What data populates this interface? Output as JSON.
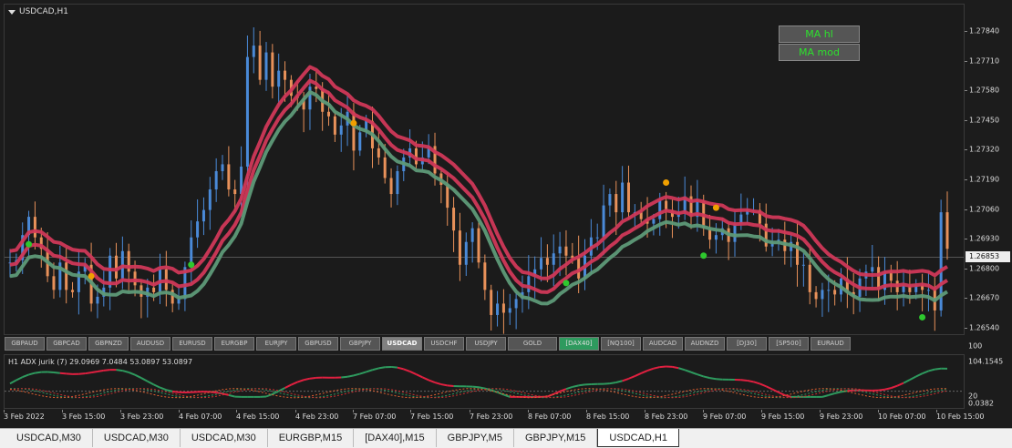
{
  "chart": {
    "title": "USDCAD,H1",
    "ma_buttons": [
      "MA hl",
      "MA mod"
    ],
    "current_price": "1.26853",
    "price_labels": [
      "1.27840",
      "1.27710",
      "1.27580",
      "1.27450",
      "1.27320",
      "1.27190",
      "1.27060",
      "1.26930",
      "1.26800",
      "1.26670",
      "1.26540"
    ]
  },
  "symbols": [
    {
      "label": "GBPAUD",
      "state": "normal"
    },
    {
      "label": "GBPCAD",
      "state": "normal"
    },
    {
      "label": "GBPNZD",
      "state": "normal"
    },
    {
      "label": "AUDUSD",
      "state": "normal"
    },
    {
      "label": "EURUSD",
      "state": "normal"
    },
    {
      "label": "EURGBP",
      "state": "normal"
    },
    {
      "label": "EURJPY",
      "state": "normal"
    },
    {
      "label": "GBPUSD",
      "state": "normal"
    },
    {
      "label": "GBPJPY",
      "state": "normal"
    },
    {
      "label": "USDCAD",
      "state": "active"
    },
    {
      "label": "USDCHF",
      "state": "normal"
    },
    {
      "label": "USDJPY",
      "state": "normal"
    },
    {
      "label": "GOLD",
      "state": "normal"
    },
    {
      "label": "[DAX40]",
      "state": "highlight"
    },
    {
      "label": "[NQ100]",
      "state": "normal"
    },
    {
      "label": "AUDCAD",
      "state": "normal"
    },
    {
      "label": "AUDNZD",
      "state": "normal"
    },
    {
      "label": "[DJ30]",
      "state": "normal"
    },
    {
      "label": "[SP500]",
      "state": "normal"
    },
    {
      "label": "EURAUD",
      "state": "normal"
    }
  ],
  "indicator": {
    "title": "H1  ADX jurik (7) 29.0969 7.0484 53.0897 53.0897",
    "labels": [
      "100",
      "104.1545",
      "20",
      "0.0382"
    ]
  },
  "time_labels": [
    "3 Feb 2022",
    "3 Feb 15:00",
    "3 Feb 23:00",
    "4 Feb 07:00",
    "4 Feb 15:00",
    "4 Feb 23:00",
    "7 Feb 07:00",
    "7 Feb 15:00",
    "7 Feb 23:00",
    "8 Feb 07:00",
    "8 Feb 15:00",
    "8 Feb 23:00",
    "9 Feb 07:00",
    "9 Feb 15:00",
    "9 Feb 23:00",
    "10 Feb 07:00",
    "10 Feb 15:00"
  ],
  "tabs": [
    "USDCAD,M30",
    "USDCAD,M30",
    "USDCAD,M30",
    "EURGBP,M15",
    "[DAX40],M15",
    "GBPJPY,M5",
    "GBPJPY,M15",
    "USDCAD,H1"
  ],
  "active_tab": "USDCAD,H1",
  "colors": {
    "bull": "#4a8ad8",
    "bear": "#e8915a",
    "ma_red": "#d03858",
    "ma_green": "#5e9a78",
    "dot_green": "#2ec82e",
    "dot_orange": "#f0a000",
    "adx_green": "#2e9a5e",
    "adx_red": "#e02040"
  },
  "chart_data": {
    "type": "candlestick",
    "symbol": "USDCAD",
    "timeframe": "H1",
    "price_range": [
      1.2654,
      1.2787
    ],
    "closes": [
      1.2683,
      1.2684,
      1.2695,
      1.2703,
      1.2694,
      1.2689,
      1.2677,
      1.2671,
      1.2683,
      1.2671,
      1.267,
      1.2679,
      1.2682,
      1.2665,
      1.2668,
      1.2672,
      1.2686,
      1.2676,
      1.2688,
      1.2679,
      1.2673,
      1.2668,
      1.2672,
      1.267,
      1.268,
      1.2671,
      1.2665,
      1.2667,
      1.2681,
      1.2694,
      1.2701,
      1.2706,
      1.2715,
      1.2723,
      1.2726,
      1.2715,
      1.2713,
      1.2725,
      1.2773,
      1.2778,
      1.2763,
      1.2775,
      1.276,
      1.2767,
      1.2763,
      1.2756,
      1.2755,
      1.275,
      1.276,
      1.2759,
      1.2749,
      1.2747,
      1.2739,
      1.2743,
      1.2749,
      1.2732,
      1.274,
      1.2745,
      1.2733,
      1.2729,
      1.272,
      1.2713,
      1.2723,
      1.2729,
      1.2733,
      1.2726,
      1.2729,
      1.2734,
      1.2722,
      1.2717,
      1.2707,
      1.2697,
      1.2682,
      1.2692,
      1.2698,
      1.2683,
      1.2671,
      1.266,
      1.2665,
      1.2661,
      1.2663,
      1.2667,
      1.267,
      1.2677,
      1.268,
      1.2685,
      1.2682,
      1.2687,
      1.269,
      1.2686,
      1.2685,
      1.2676,
      1.2686,
      1.2694,
      1.2694,
      1.2708,
      1.2713,
      1.2705,
      1.2718,
      1.2705,
      1.2705,
      1.2702,
      1.27,
      1.2702,
      1.271,
      1.2706,
      1.2703,
      1.2705,
      1.2712,
      1.2703,
      1.271,
      1.2698,
      1.2693,
      1.2695,
      1.2698,
      1.2692,
      1.27,
      1.2704,
      1.2706,
      1.2706,
      1.27,
      1.269,
      1.2692,
      1.2693,
      1.2688,
      1.2692,
      1.2682,
      1.2682,
      1.267,
      1.2667,
      1.2671,
      1.2671,
      1.2669,
      1.2676,
      1.267,
      1.2668,
      1.2676,
      1.2679,
      1.2681,
      1.2671,
      1.2679,
      1.2675,
      1.267,
      1.2673,
      1.267,
      1.2673,
      1.2671,
      1.2671,
      1.2662,
      1.2705,
      1.2689
    ]
  }
}
